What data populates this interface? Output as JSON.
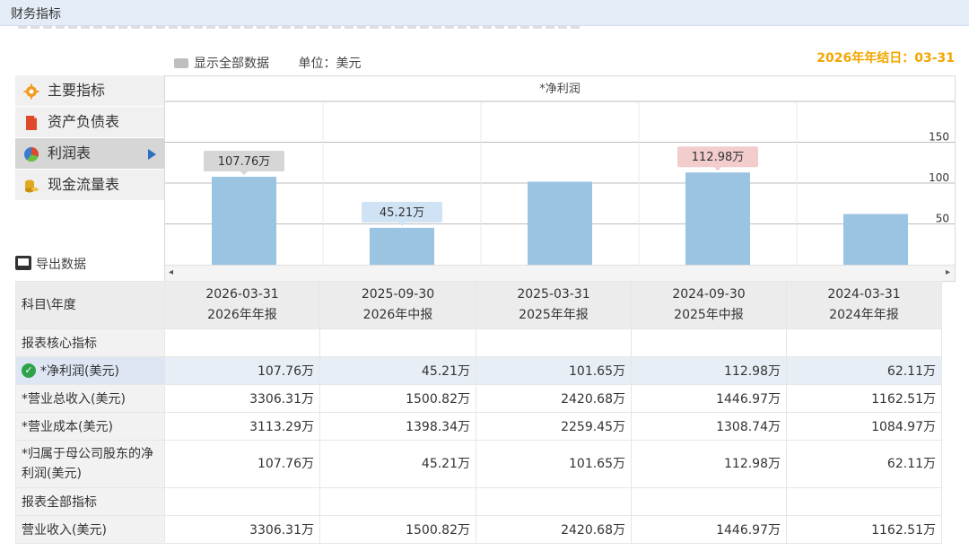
{
  "header": {
    "title": "财务指标"
  },
  "fiscal_year_end": "2026年年结日：03-31",
  "toolbar": {
    "show_all_label": "显示全部数据",
    "unit_label": "单位：美元"
  },
  "sidebar": {
    "items": [
      {
        "label": "主要指标",
        "icon": "gear-icon",
        "color": "#f29c1f",
        "active": false
      },
      {
        "label": "资产负债表",
        "icon": "document-icon",
        "color": "#e0482a",
        "active": false
      },
      {
        "label": "利润表",
        "icon": "pie-chart-icon",
        "color": "#3b7ccf",
        "active": true
      },
      {
        "label": "现金流量表",
        "icon": "coins-icon",
        "color": "#e0a81f",
        "active": false
      }
    ]
  },
  "export_label": "导出数据",
  "chart_data": {
    "type": "bar",
    "title": "*净利润",
    "categories": [
      "2026-03-31",
      "2025-09-30",
      "2025-03-31",
      "2024-09-30",
      "2024-03-31"
    ],
    "values": [
      107.76,
      45.21,
      101.65,
      112.98,
      62.11
    ],
    "ylim": [
      0,
      200
    ],
    "yticks": [
      50,
      100,
      150
    ],
    "data_labels": [
      "107.76万",
      "45.21万",
      "",
      "112.98万",
      ""
    ],
    "label_colors": [
      "#d6d6d6",
      "#cfe3f5",
      "",
      "#f3cccc",
      ""
    ],
    "bar_color": "#9bc3e2",
    "grid": true
  },
  "table": {
    "corner_label": "科目\\年度",
    "columns": [
      {
        "date": "2026-03-31",
        "period": "2026年年报"
      },
      {
        "date": "2025-09-30",
        "period": "2026年中报"
      },
      {
        "date": "2025-03-31",
        "period": "2025年年报"
      },
      {
        "date": "2024-09-30",
        "period": "2025年中报"
      },
      {
        "date": "2024-03-31",
        "period": "2024年年报"
      }
    ],
    "rows": [
      {
        "label": "报表核心指标",
        "section": true,
        "values": []
      },
      {
        "label": "*净利润(美元)",
        "selected": true,
        "values": [
          "107.76万",
          "45.21万",
          "101.65万",
          "112.98万",
          "62.11万"
        ]
      },
      {
        "label": "*营业总收入(美元)",
        "values": [
          "3306.31万",
          "1500.82万",
          "2420.68万",
          "1446.97万",
          "1162.51万"
        ]
      },
      {
        "label": "*营业成本(美元)",
        "values": [
          "3113.29万",
          "1398.34万",
          "2259.45万",
          "1308.74万",
          "1084.97万"
        ]
      },
      {
        "label": "*归属于母公司股东的净利润(美元)",
        "tall": true,
        "values": [
          "107.76万",
          "45.21万",
          "101.65万",
          "112.98万",
          "62.11万"
        ]
      },
      {
        "label": "报表全部指标",
        "section": true,
        "values": []
      },
      {
        "label": "营业收入(美元)",
        "values": [
          "3306.31万",
          "1500.82万",
          "2420.68万",
          "1446.97万",
          "1162.51万"
        ]
      }
    ]
  }
}
